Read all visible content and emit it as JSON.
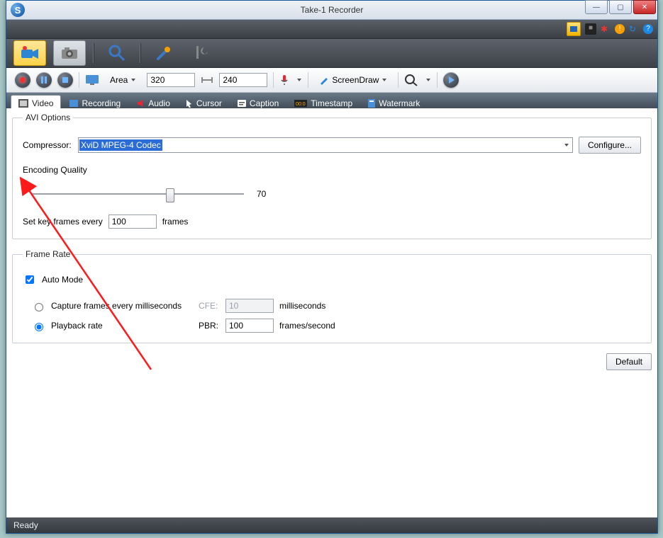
{
  "window": {
    "title": "Take-1 Recorder"
  },
  "toolbar": {
    "area_label": "Area",
    "width_value": "320",
    "height_value": "240",
    "screendraw_label": "ScreenDraw"
  },
  "tabs": [
    {
      "label": "Video"
    },
    {
      "label": "Recording"
    },
    {
      "label": "Audio"
    },
    {
      "label": "Cursor"
    },
    {
      "label": "Caption"
    },
    {
      "label": "Timestamp"
    },
    {
      "label": "Watermark"
    }
  ],
  "avi": {
    "legend": "AVI Options",
    "compressor_label": "Compressor:",
    "compressor_value": "XviD MPEG-4 Codec",
    "configure_label": "Configure...",
    "encoding_quality_label": "Encoding Quality",
    "quality_value": "70",
    "keyframes_prefix": "Set key frames every",
    "keyframes_value": "100",
    "keyframes_suffix": "frames"
  },
  "framerate": {
    "legend": "Frame Rate",
    "auto_label": "Auto Mode",
    "auto_checked": true,
    "cfe_label": "Capture frames every milliseconds",
    "cfe_abbr": "CFE:",
    "cfe_value": "10",
    "cfe_unit": "milliseconds",
    "pbr_label": "Playback rate",
    "pbr_abbr": "PBR:",
    "pbr_value": "100",
    "pbr_unit": "frames/second",
    "selected": "pbr"
  },
  "buttons": {
    "default": "Default"
  },
  "status": {
    "text": "Ready"
  }
}
